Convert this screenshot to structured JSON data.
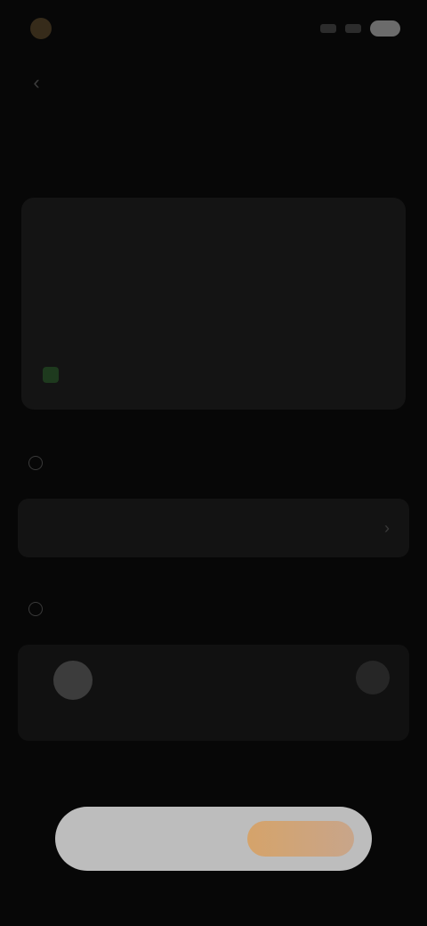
{
  "status_bar": {
    "time": "",
    "icons": [
      "signal-icon",
      "wifi-icon",
      "battery-icon"
    ]
  },
  "nav": {
    "back_glyph": "‹",
    "title": ""
  },
  "description": {
    "text": "",
    "status": "",
    "meta": ""
  },
  "recommended": {
    "title": "",
    "item_text": ""
  },
  "options": {
    "title": "",
    "left_caption": "",
    "right_caption": ""
  },
  "action_bar": {
    "label": "",
    "pill_label": ""
  },
  "colors": {
    "background": "#070707",
    "card": "#141414",
    "accent_pill": "#d5a36a",
    "status_green": "#1e3a1e"
  }
}
